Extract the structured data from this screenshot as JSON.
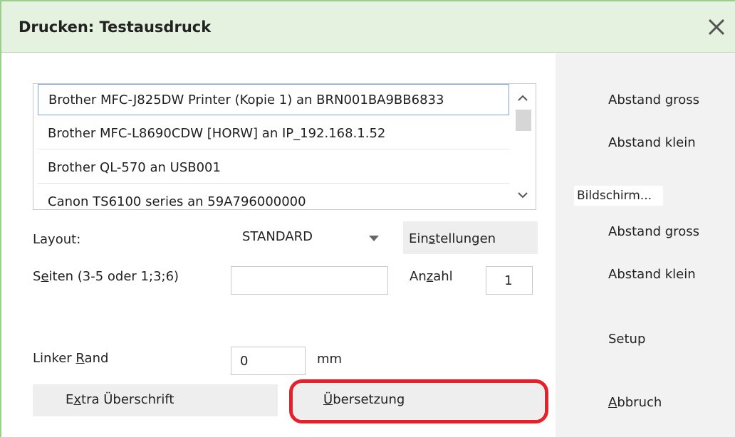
{
  "window": {
    "title": "Drucken: Testausdruck",
    "close_icon": "close-icon"
  },
  "printers": {
    "items": [
      "Brother MFC-J825DW Printer (Kopie 1) an BRN001BA9BB6833",
      "Brother MFC-L8690CDW [HORW] an IP_192.168.1.52",
      "Brother QL-570 an USB001",
      "Canon TS6100 series an 59A796000000"
    ],
    "selected_index": 0
  },
  "layout": {
    "label": "Layout:",
    "value": "STANDARD",
    "settings_button": {
      "pre": "Ein",
      "underlined": "s",
      "post": "tellungen"
    }
  },
  "pages": {
    "label_pre": "S",
    "label_underlined": "e",
    "label_post": "iten (3-5 oder 1;3;6)",
    "value": ""
  },
  "count": {
    "label_pre": "An",
    "label_underlined": "z",
    "label_post": "ahl",
    "value": "1"
  },
  "margin": {
    "label_pre": "Linker ",
    "label_underlined": "R",
    "label_post": "and",
    "value": "0",
    "unit": "mm"
  },
  "buttons": {
    "extra": {
      "pre": "E",
      "underlined": "x",
      "post": "tra Überschrift"
    },
    "translation": {
      "pre": "",
      "underlined": "Ü",
      "post": "bersetzung"
    }
  },
  "right_panel": {
    "abstand_gross_1": "Abstand gross",
    "abstand_klein_1": "Abstand klein",
    "bildschirm": "Bildschirm...",
    "abstand_gross_2": "Abstand gross",
    "abstand_klein_2": "Abstand klein",
    "setup": "Setup",
    "abbruch_underlined": "A",
    "abbruch_post": "bbruch"
  },
  "colors": {
    "titlebar": "#e4f2df",
    "highlight": "#e8202a",
    "selection_border": "#7aa7e0"
  }
}
